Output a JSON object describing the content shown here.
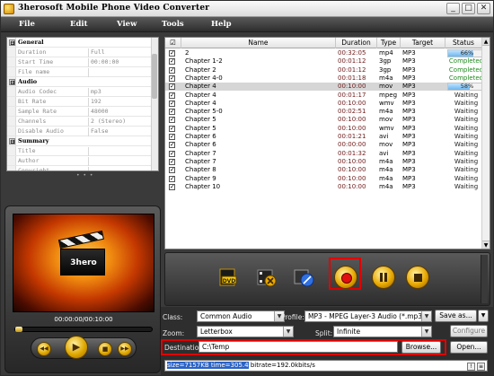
{
  "window": {
    "title": "3herosoft Mobile Phone Video Converter",
    "controls": {
      "minimize": "_",
      "maximize": "□",
      "close": "✕"
    }
  },
  "menu": [
    "File",
    "Edit",
    "View",
    "Tools",
    "Help"
  ],
  "properties": {
    "groups": [
      {
        "name": "General",
        "expander": "⊟",
        "rows": [
          {
            "name": "Duration",
            "value": "Full"
          },
          {
            "name": "Start Time",
            "value": "00:00:00"
          },
          {
            "name": "File name",
            "value": ""
          }
        ]
      },
      {
        "name": "Audio",
        "expander": "⊟",
        "rows": [
          {
            "name": "Audio Codec",
            "value": "mp3"
          },
          {
            "name": "Bit Rate",
            "value": "192"
          },
          {
            "name": "Sample Rate",
            "value": "48000"
          },
          {
            "name": "Channels",
            "value": "2 (Stereo)"
          },
          {
            "name": "Disable Audio",
            "value": "False"
          }
        ]
      },
      {
        "name": "Summary",
        "expander": "⊟",
        "rows": [
          {
            "name": "Title",
            "value": ""
          },
          {
            "name": "Author",
            "value": ""
          },
          {
            "name": "Copyright",
            "value": ""
          }
        ]
      }
    ],
    "grip": "• • •"
  },
  "player": {
    "logo_text": "3hero",
    "time": "00:00:00/00:10:00",
    "seek_position": 0.0,
    "controls": [
      {
        "icon": "prev-icon",
        "glyph": "◀◀"
      },
      {
        "icon": "play-icon",
        "glyph": "▶"
      },
      {
        "icon": "stop-icon",
        "glyph": "■"
      },
      {
        "icon": "next-icon",
        "glyph": "▶▶"
      }
    ]
  },
  "grid": {
    "columns": [
      "☑",
      "Name",
      "Duration",
      "Type",
      "Target",
      "Status"
    ],
    "rows": [
      {
        "name": "2",
        "duration": "00:32:05",
        "type": "mp4",
        "target": "MP3",
        "status": "66%",
        "progress": 0.66,
        "kind": "progress"
      },
      {
        "name": "Chapter 1-2",
        "duration": "00:01:12",
        "type": "3gp",
        "target": "MP3",
        "status": "Completed",
        "kind": "done"
      },
      {
        "name": "Chapter 2",
        "duration": "00:01:12",
        "type": "3gp",
        "target": "MP3",
        "status": "Completed",
        "kind": "done"
      },
      {
        "name": "Chapter 4-0",
        "duration": "00:01:18",
        "type": "m4a",
        "target": "MP3",
        "status": "Completed",
        "kind": "done"
      },
      {
        "name": "Chapter 4",
        "duration": "00:10:00",
        "type": "mov",
        "target": "MP3",
        "status": "58%",
        "progress": 0.58,
        "kind": "progress",
        "selected": true
      },
      {
        "name": "Chapter 4",
        "duration": "00:01:17",
        "type": "mpeg",
        "target": "MP3",
        "status": "Waiting",
        "kind": "wait"
      },
      {
        "name": "Chapter 4",
        "duration": "00:10:00",
        "type": "wmv",
        "target": "MP3",
        "status": "Waiting",
        "kind": "wait"
      },
      {
        "name": "Chapter 5-0",
        "duration": "00:02:51",
        "type": "m4a",
        "target": "MP3",
        "status": "Waiting",
        "kind": "wait"
      },
      {
        "name": "Chapter 5",
        "duration": "00:10:00",
        "type": "mov",
        "target": "MP3",
        "status": "Waiting",
        "kind": "wait"
      },
      {
        "name": "Chapter 5",
        "duration": "00:10:00",
        "type": "wmv",
        "target": "MP3",
        "status": "Waiting",
        "kind": "wait"
      },
      {
        "name": "Chapter 6",
        "duration": "00:01:21",
        "type": "avi",
        "target": "MP3",
        "status": "Waiting",
        "kind": "wait"
      },
      {
        "name": "Chapter 6",
        "duration": "00:00:00",
        "type": "mov",
        "target": "MP3",
        "status": "Waiting",
        "kind": "wait"
      },
      {
        "name": "Chapter 7",
        "duration": "00:01:32",
        "type": "avi",
        "target": "MP3",
        "status": "Waiting",
        "kind": "wait"
      },
      {
        "name": "Chapter 7",
        "duration": "00:10:00",
        "type": "m4a",
        "target": "MP3",
        "status": "Waiting",
        "kind": "wait"
      },
      {
        "name": "Chapter 8",
        "duration": "00:10:00",
        "type": "m4a",
        "target": "MP3",
        "status": "Waiting",
        "kind": "wait"
      },
      {
        "name": "Chapter 9",
        "duration": "00:10:00",
        "type": "m4a",
        "target": "MP3",
        "status": "Waiting",
        "kind": "wait"
      },
      {
        "name": "Chapter 10",
        "duration": "00:10:00",
        "type": "m4a",
        "target": "MP3",
        "status": "Waiting",
        "kind": "wait"
      }
    ]
  },
  "actions": [
    {
      "icon": "add-dvd-icon"
    },
    {
      "icon": "remove-video-icon"
    },
    {
      "icon": "snapshot-icon"
    },
    {
      "icon": "record-icon",
      "highlighted": true
    },
    {
      "icon": "pause-icon"
    },
    {
      "icon": "stop-icon"
    }
  ],
  "settings": {
    "class_label": "Class:",
    "class_value": "Common Audio",
    "profile_label": "Profile:",
    "profile_value": "MP3 - MPEG Layer-3 Audio  (*.mp3)",
    "save_as": "Save as...",
    "zoom_label": "Zoom:",
    "zoom_value": "Letterbox",
    "split_label": "Split:",
    "split_value": "Infinite",
    "configure": "Configure",
    "destination_label": "Destination:",
    "destination_value": "C:\\Temp",
    "browse": "Browse...",
    "open": "Open..."
  },
  "status": {
    "selected_text": "size=7157KB time=305.4",
    "rest_text": " bitrate=192.0kbits/s",
    "buttons": [
      "!",
      "≡"
    ]
  },
  "colors": {
    "accent_gold": "#e0a800",
    "highlight_red": "#e00000",
    "completed_green": "#1d8a1d",
    "selection_blue": "#2b63c6"
  }
}
